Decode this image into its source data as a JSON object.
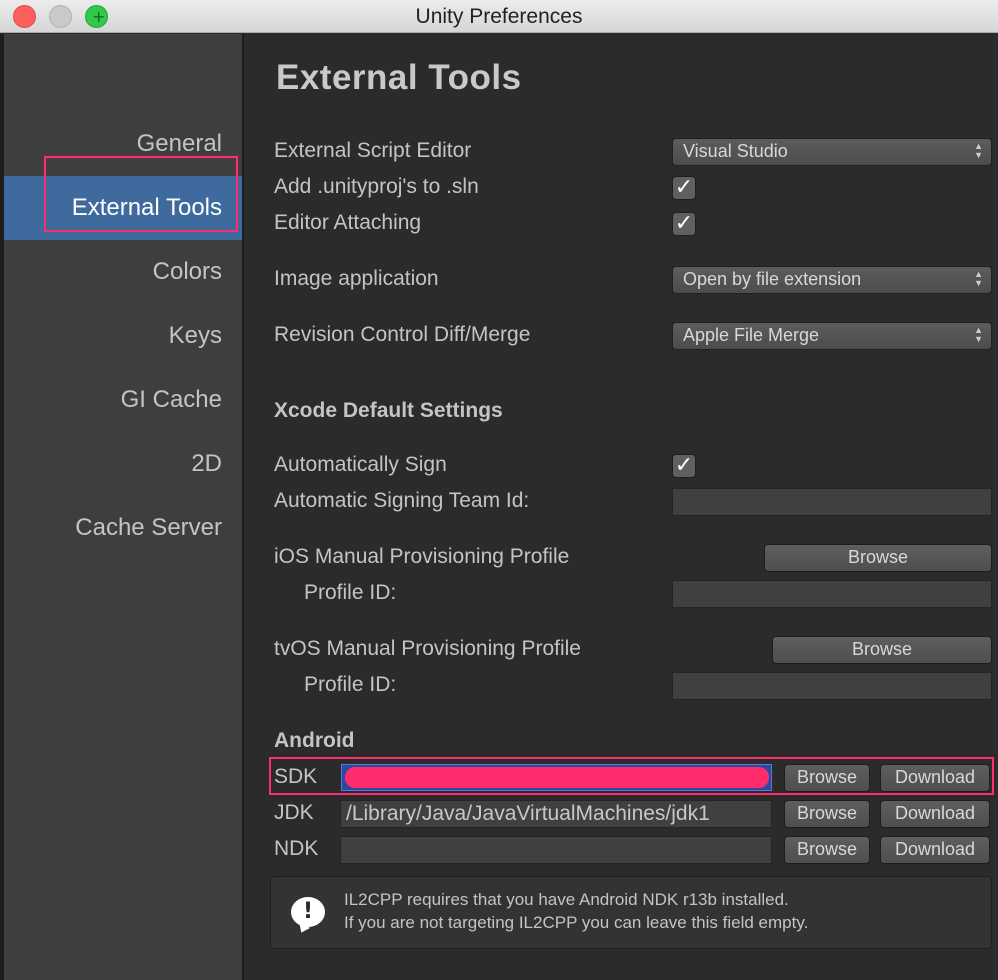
{
  "window": {
    "title": "Unity Preferences"
  },
  "sidebar": {
    "items": [
      {
        "label": "General"
      },
      {
        "label": "External Tools",
        "selected": true
      },
      {
        "label": "Colors"
      },
      {
        "label": "Keys"
      },
      {
        "label": "GI Cache"
      },
      {
        "label": "2D"
      },
      {
        "label": "Cache Server"
      }
    ]
  },
  "main": {
    "title": "External Tools",
    "external_script_editor": {
      "label": "External Script Editor",
      "value": "Visual Studio"
    },
    "add_unityproj": {
      "label": "Add .unityproj's to .sln",
      "checked": true,
      "check_glyph": "✓"
    },
    "editor_attaching": {
      "label": "Editor Attaching",
      "checked": true,
      "check_glyph": "✓"
    },
    "image_application": {
      "label": "Image application",
      "value": "Open by file extension"
    },
    "revision_control": {
      "label": "Revision Control Diff/Merge",
      "value": "Apple File Merge"
    },
    "popup_arrows": "▲\n▼",
    "xcode": {
      "section_label": "Xcode Default Settings",
      "automatically_sign": {
        "label": "Automatically Sign",
        "checked": true,
        "check_glyph": "✓"
      },
      "signing_team": {
        "label": "Automatic Signing Team Id:",
        "value": ""
      },
      "ios_profile": {
        "label": "iOS Manual Provisioning Profile",
        "browse_label": "Browse"
      },
      "ios_profile_id": {
        "label": "Profile ID:",
        "value": ""
      },
      "tvos_profile": {
        "label": "tvOS Manual Provisioning Profile",
        "browse_label": "Browse"
      },
      "tvos_profile_id": {
        "label": "Profile ID:",
        "value": ""
      }
    },
    "android": {
      "section_label": "Android",
      "sdk": {
        "label": "SDK",
        "browse_label": "Browse",
        "download_label": "Download"
      },
      "jdk": {
        "label": "JDK",
        "value": "/Library/Java/JavaVirtualMachines/jdk1",
        "browse_label": "Browse",
        "download_label": "Download"
      },
      "ndk": {
        "label": "NDK",
        "value": "",
        "browse_label": "Browse",
        "download_label": "Download"
      },
      "help": {
        "icon": "!",
        "line1": "IL2CPP requires that you have Android NDK r13b installed.",
        "line2": "If you are not targeting IL2CPP you can leave this field empty."
      }
    }
  },
  "colors": {
    "selection_highlight": "#3e6a9e",
    "annotation_outline": "#ff2d6e",
    "redaction": "#ff2d6e"
  }
}
